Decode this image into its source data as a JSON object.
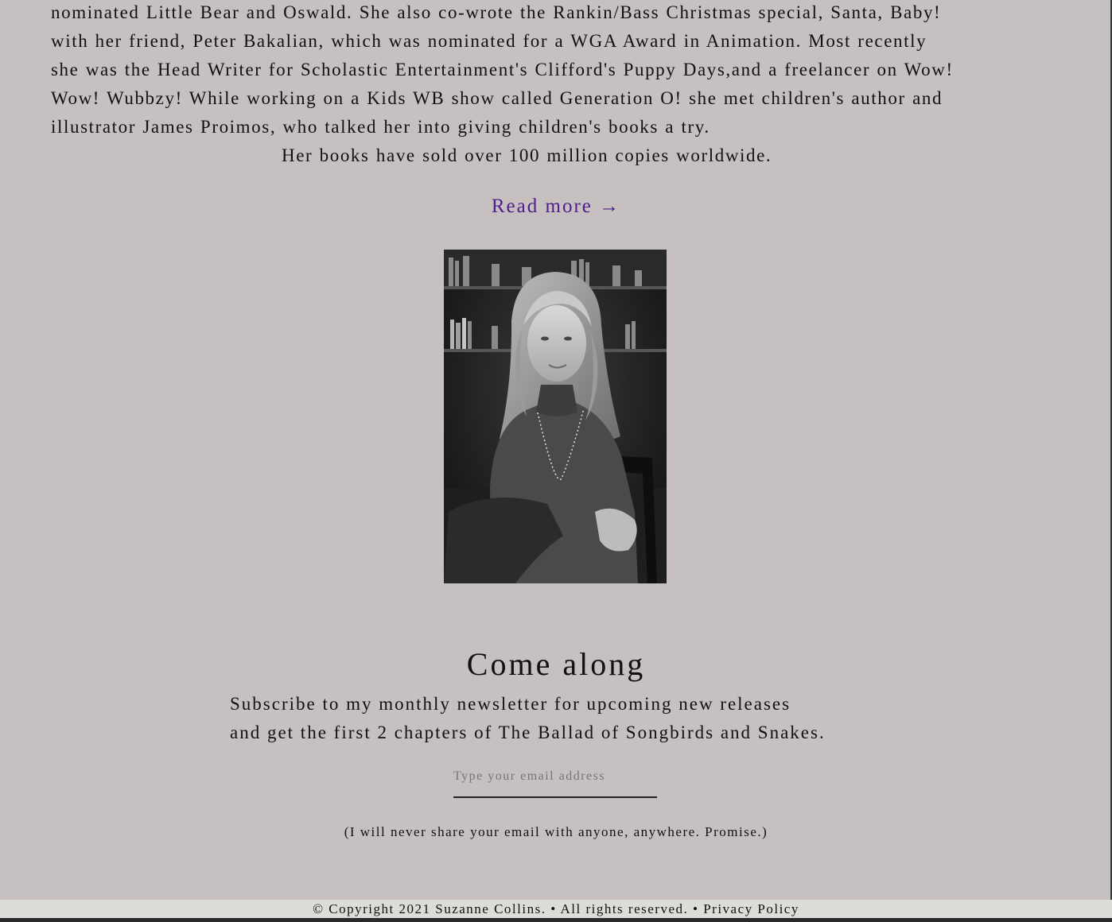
{
  "bio": {
    "lines": [
      "nominated Little Bear and Oswald. She also co-wrote the Rankin/Bass Christmas special, Santa, Baby!",
      "with her friend, Peter Bakalian, which was nominated for a WGA Award in Animation. Most recently",
      "she was the Head Writer for Scholastic Entertainment's Clifford's Puppy Days,and a freelancer on Wow!",
      "Wow! Wubbzy! While working on a Kids WB show called Generation O! she met children's author and",
      "illustrator James Proimos, who talked her into giving children's books a try."
    ],
    "sales_line": "Her books have sold over 100 million copies worldwide."
  },
  "read_more": {
    "label": "Read more →"
  },
  "newsletter": {
    "heading": "Come along",
    "line1": "Subscribe to my monthly newsletter for upcoming new releases",
    "line2": "and get the first 2 chapters of The Ballad of Songbirds and Snakes.",
    "email_placeholder": "Type your email address",
    "email_value": "",
    "promise": "(I will never share your email with anyone, anywhere. Promise.)"
  },
  "footer": {
    "copyright": "© Copyright 2021 Suzanne Collins. • All rights reserved. •",
    "privacy_label": "Privacy Policy"
  },
  "colors": {
    "background": "#c6c0c0",
    "link": "#4e1e8a",
    "footer_bg": "#dcdcd8"
  }
}
